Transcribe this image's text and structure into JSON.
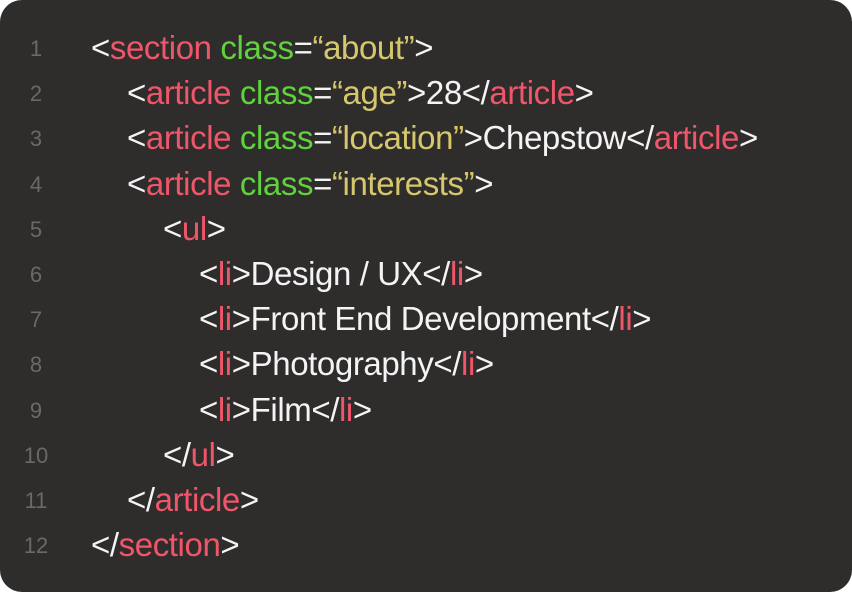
{
  "colors": {
    "background": "#2f2c2c",
    "punctuation": "#f4f4f4",
    "tag": "#f0566a",
    "attribute": "#5fd23c",
    "string": "#d7c76c",
    "text": "#f4f4f4",
    "gutter": "#6b6868"
  },
  "lines": [
    {
      "number": "1",
      "indent": 0,
      "tokens": [
        {
          "t": "p",
          "v": "<"
        },
        {
          "t": "tag",
          "v": "section"
        },
        {
          "t": "p",
          "v": " "
        },
        {
          "t": "attr",
          "v": "class"
        },
        {
          "t": "p",
          "v": "="
        },
        {
          "t": "str",
          "v": "“about”"
        },
        {
          "t": "p",
          "v": ">"
        }
      ]
    },
    {
      "number": "2",
      "indent": 1,
      "tokens": [
        {
          "t": "p",
          "v": "<"
        },
        {
          "t": "tag",
          "v": "article"
        },
        {
          "t": "p",
          "v": " "
        },
        {
          "t": "attr",
          "v": "class"
        },
        {
          "t": "p",
          "v": "="
        },
        {
          "t": "str",
          "v": "“age”"
        },
        {
          "t": "p",
          "v": ">"
        },
        {
          "t": "text",
          "v": "28"
        },
        {
          "t": "p",
          "v": "</"
        },
        {
          "t": "tag",
          "v": "article"
        },
        {
          "t": "p",
          "v": ">"
        }
      ]
    },
    {
      "number": "3",
      "indent": 1,
      "tokens": [
        {
          "t": "p",
          "v": "<"
        },
        {
          "t": "tag",
          "v": "article"
        },
        {
          "t": "p",
          "v": " "
        },
        {
          "t": "attr",
          "v": "class"
        },
        {
          "t": "p",
          "v": "="
        },
        {
          "t": "str",
          "v": "“location”"
        },
        {
          "t": "p",
          "v": ">"
        },
        {
          "t": "text",
          "v": "Chepstow"
        },
        {
          "t": "p",
          "v": "</"
        },
        {
          "t": "tag",
          "v": "article"
        },
        {
          "t": "p",
          "v": ">"
        }
      ]
    },
    {
      "number": "4",
      "indent": 1,
      "tokens": [
        {
          "t": "p",
          "v": "<"
        },
        {
          "t": "tag",
          "v": "article"
        },
        {
          "t": "p",
          "v": " "
        },
        {
          "t": "attr",
          "v": "class"
        },
        {
          "t": "p",
          "v": "="
        },
        {
          "t": "str",
          "v": "“interests”"
        },
        {
          "t": "p",
          "v": ">"
        }
      ]
    },
    {
      "number": "5",
      "indent": 2,
      "tokens": [
        {
          "t": "p",
          "v": "<"
        },
        {
          "t": "tag",
          "v": "ul"
        },
        {
          "t": "p",
          "v": ">"
        }
      ]
    },
    {
      "number": "6",
      "indent": 3,
      "tokens": [
        {
          "t": "p",
          "v": "<"
        },
        {
          "t": "tag",
          "v": "li"
        },
        {
          "t": "p",
          "v": ">"
        },
        {
          "t": "text",
          "v": "Design / UX"
        },
        {
          "t": "p",
          "v": "</"
        },
        {
          "t": "tag",
          "v": "li"
        },
        {
          "t": "p",
          "v": ">"
        }
      ]
    },
    {
      "number": "7",
      "indent": 3,
      "tokens": [
        {
          "t": "p",
          "v": "<"
        },
        {
          "t": "tag",
          "v": "li"
        },
        {
          "t": "p",
          "v": ">"
        },
        {
          "t": "text",
          "v": "Front End Development"
        },
        {
          "t": "p",
          "v": "</"
        },
        {
          "t": "tag",
          "v": "li"
        },
        {
          "t": "p",
          "v": ">"
        }
      ]
    },
    {
      "number": "8",
      "indent": 3,
      "tokens": [
        {
          "t": "p",
          "v": "<"
        },
        {
          "t": "tag",
          "v": "li"
        },
        {
          "t": "p",
          "v": ">"
        },
        {
          "t": "text",
          "v": "Photography"
        },
        {
          "t": "p",
          "v": "</"
        },
        {
          "t": "tag",
          "v": "li"
        },
        {
          "t": "p",
          "v": ">"
        }
      ]
    },
    {
      "number": "9",
      "indent": 3,
      "tokens": [
        {
          "t": "p",
          "v": "<"
        },
        {
          "t": "tag",
          "v": "li"
        },
        {
          "t": "p",
          "v": ">"
        },
        {
          "t": "text",
          "v": "Film"
        },
        {
          "t": "p",
          "v": "</"
        },
        {
          "t": "tag",
          "v": "li"
        },
        {
          "t": "p",
          "v": ">"
        }
      ]
    },
    {
      "number": "10",
      "indent": 2,
      "tokens": [
        {
          "t": "p",
          "v": "</"
        },
        {
          "t": "tag",
          "v": "ul"
        },
        {
          "t": "p",
          "v": ">"
        }
      ]
    },
    {
      "number": "11",
      "indent": 1,
      "tokens": [
        {
          "t": "p",
          "v": "</"
        },
        {
          "t": "tag",
          "v": "article"
        },
        {
          "t": "p",
          "v": ">"
        }
      ]
    },
    {
      "number": "12",
      "indent": 0,
      "tokens": [
        {
          "t": "p",
          "v": "</"
        },
        {
          "t": "tag",
          "v": "section"
        },
        {
          "t": "p",
          "v": ">"
        }
      ]
    }
  ]
}
